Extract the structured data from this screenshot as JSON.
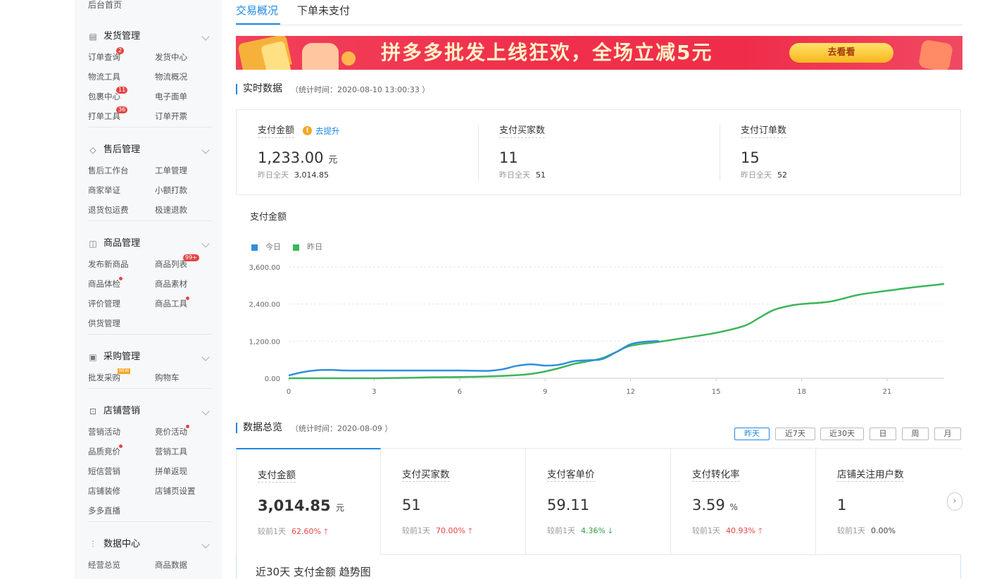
{
  "sidebar": {
    "top_link": "后台首页",
    "sections": [
      {
        "icon": "document-icon",
        "title": "发货管理",
        "items": [
          {
            "label": "订单查询",
            "badge": "2"
          },
          {
            "label": "发货中心"
          },
          {
            "label": "物流工具"
          },
          {
            "label": "物流概况"
          },
          {
            "label": "包裹中心",
            "badge": "11"
          },
          {
            "label": "电子面单"
          },
          {
            "label": "打单工具",
            "badge": "36"
          },
          {
            "label": "订单开票"
          }
        ]
      },
      {
        "icon": "shield-icon",
        "title": "售后管理",
        "items": [
          {
            "label": "售后工作台"
          },
          {
            "label": "工单管理"
          },
          {
            "label": "商家举证"
          },
          {
            "label": "小额打款"
          },
          {
            "label": "退货包运费"
          },
          {
            "label": "极速退款"
          }
        ]
      },
      {
        "icon": "bag-icon",
        "title": "商品管理",
        "items": [
          {
            "label": "发布新商品"
          },
          {
            "label": "商品列表",
            "badge": "99+"
          },
          {
            "label": "商品体检",
            "dot": true
          },
          {
            "label": "商品素材"
          },
          {
            "label": "评价管理"
          },
          {
            "label": "商品工具",
            "dot": true
          },
          {
            "label": "供货管理"
          }
        ]
      },
      {
        "icon": "cart-icon",
        "title": "采购管理",
        "items": [
          {
            "label": "批发采购",
            "new": "NEW"
          },
          {
            "label": "购物车"
          }
        ]
      },
      {
        "icon": "gift-icon",
        "title": "店铺营销",
        "items": [
          {
            "label": "营销活动"
          },
          {
            "label": "竞价活动",
            "dot": true
          },
          {
            "label": "品质竞价",
            "dot": true
          },
          {
            "label": "营销工具"
          },
          {
            "label": "短信营销"
          },
          {
            "label": "拼单返现"
          },
          {
            "label": "店铺装修"
          },
          {
            "label": "店铺页设置"
          },
          {
            "label": "多多直播"
          }
        ]
      },
      {
        "icon": "bar-chart-icon",
        "title": "数据中心",
        "items": [
          {
            "label": "经营总览"
          },
          {
            "label": "商品数据"
          }
        ]
      }
    ]
  },
  "tabs": [
    {
      "label": "交易概况",
      "active": true
    },
    {
      "label": "下单未支付",
      "active": false
    }
  ],
  "banner": {
    "text": "拼多多批发上线狂欢，全场立减5元",
    "button": "去看看"
  },
  "realtime": {
    "title": "实时数据",
    "time": "（统计时间：2020-08-10 13:00:33 ）",
    "boost_link": "去提升",
    "metrics": [
      {
        "label": "支付金额",
        "value": "1,233.00",
        "unit": "元",
        "yesterday_label": "昨日全天",
        "yesterday": "3,014.85"
      },
      {
        "label": "支付买家数",
        "value": "11",
        "unit": "",
        "yesterday_label": "昨日全天",
        "yesterday": "51"
      },
      {
        "label": "支付订单数",
        "value": "15",
        "unit": "",
        "yesterday_label": "昨日全天",
        "yesterday": "52"
      }
    ]
  },
  "chart_title": "支付金额",
  "chart_data": {
    "type": "line",
    "title": "支付金额",
    "xlabel": "",
    "ylabel": "",
    "xlim": [
      0,
      23
    ],
    "ylim": [
      0,
      3600
    ],
    "xticks": [
      "0",
      "3",
      "6",
      "9",
      "12",
      "15",
      "18",
      "21"
    ],
    "xtick_values": [
      0,
      3,
      6,
      9,
      12,
      15,
      18,
      21
    ],
    "yticks": [
      "0.00",
      "1,200.00",
      "2,400.00",
      "3,600.00"
    ],
    "ytick_values": [
      0,
      1200,
      2400,
      3600
    ],
    "grid": "horizontal-dashed",
    "legend_position": "top-left",
    "series": [
      {
        "name": "今日",
        "color": "#2f8fdd",
        "x": [
          0,
          0.5,
          1,
          1.5,
          2,
          3,
          4,
          5,
          6,
          7,
          7.5,
          8,
          8.5,
          9,
          9.5,
          10,
          10.5,
          11,
          11.5,
          12,
          12.5,
          13
        ],
        "y": [
          90,
          200,
          260,
          270,
          250,
          250,
          250,
          250,
          250,
          240,
          290,
          400,
          450,
          410,
          440,
          550,
          580,
          620,
          850,
          1100,
          1180,
          1200
        ]
      },
      {
        "name": "昨日",
        "color": "#3cb55a",
        "x": [
          0,
          1,
          2,
          3,
          4,
          5,
          6,
          7,
          8,
          8.5,
          9,
          9.5,
          10,
          10.5,
          11,
          11.5,
          12,
          13,
          14,
          15,
          16,
          16.5,
          17,
          17.5,
          18,
          19,
          20,
          21,
          22,
          23
        ],
        "y": [
          0,
          0,
          0,
          0,
          10,
          30,
          40,
          60,
          100,
          140,
          220,
          330,
          460,
          550,
          650,
          850,
          1050,
          1180,
          1320,
          1470,
          1700,
          1950,
          2200,
          2330,
          2400,
          2480,
          2700,
          2830,
          2950,
          3050
        ]
      }
    ]
  },
  "overview": {
    "title": "数据总览",
    "time": "（统计时间：2020-08-09 ）",
    "ranges": [
      {
        "label": "昨天",
        "active": true
      },
      {
        "label": "近7天",
        "active": false
      },
      {
        "label": "近30天",
        "active": false
      },
      {
        "label": "日",
        "active": false
      },
      {
        "label": "周",
        "active": false
      },
      {
        "label": "月",
        "active": false
      }
    ],
    "cards": [
      {
        "label": "支付金额",
        "value": "3,014.85",
        "unit": "元",
        "cmp_label": "较前1天",
        "pct": "62.60%",
        "trend": "up"
      },
      {
        "label": "支付买家数",
        "value": "51",
        "unit": "",
        "cmp_label": "较前1天",
        "pct": "70.00%",
        "trend": "up"
      },
      {
        "label": "支付客单价",
        "value": "59.11",
        "unit": "",
        "cmp_label": "较前1天",
        "pct": "4.36%",
        "trend": "down"
      },
      {
        "label": "支付转化率",
        "value": "3.59",
        "unit": "%",
        "cmp_label": "较前1天",
        "pct": "40.93%",
        "trend": "up"
      },
      {
        "label": "店铺关注用户数",
        "value": "1",
        "unit": "",
        "cmp_label": "较前1天",
        "pct": "0.00%",
        "trend": "flat"
      }
    ],
    "trend_title": "近30天 支付金额 趋势图"
  }
}
